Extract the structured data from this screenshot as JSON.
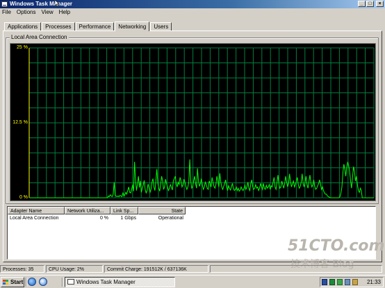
{
  "window": {
    "title": "Windows Task Manager",
    "buttons": {
      "minimize": "_",
      "maximize": "□",
      "close": "×"
    }
  },
  "menu": [
    "File",
    "Options",
    "View",
    "Help"
  ],
  "tabs": [
    {
      "label": "Applications",
      "active": false
    },
    {
      "label": "Processes",
      "active": false
    },
    {
      "label": "Performance",
      "active": false
    },
    {
      "label": "Networking",
      "active": true
    },
    {
      "label": "Users",
      "active": false
    }
  ],
  "graph": {
    "group_label": "Local Area Connection",
    "y_tick_labels": [
      "25 %",
      "12.5 %",
      "0 %"
    ],
    "colors": {
      "background": "#000000",
      "grid": "#008040",
      "line": "#00ff00",
      "axis_label": "#ffff00"
    }
  },
  "chart_data": {
    "type": "line",
    "title": "Local Area Connection",
    "xlabel": "",
    "ylabel": "",
    "ylim": [
      0,
      25
    ],
    "y_ticks": [
      "0 %",
      "12.5 %",
      "25 %"
    ],
    "grid": true,
    "series": [
      {
        "name": "",
        "values": [
          0,
          0,
          0,
          0,
          0,
          0,
          0,
          0,
          0,
          0,
          0,
          0,
          0,
          0,
          0,
          0,
          0,
          0,
          0,
          0,
          0,
          0,
          0,
          0,
          0,
          0,
          0,
          0,
          0,
          0,
          0,
          0,
          0,
          0,
          0,
          0,
          0,
          0,
          0,
          0,
          0,
          0,
          0,
          0,
          0,
          0,
          0,
          0,
          0,
          0,
          0,
          0,
          0,
          0,
          0,
          0,
          0,
          0,
          0,
          0,
          0,
          0,
          0,
          0,
          0,
          0,
          0,
          0,
          0,
          0,
          0,
          0,
          0,
          0,
          0,
          0,
          0,
          0,
          0,
          0,
          0,
          0.3,
          0.2,
          0.5,
          0.3,
          0.2,
          0.6,
          2.6,
          0.4,
          0.3,
          0.2,
          0.3,
          0.2,
          0.4,
          0.3,
          0.2,
          0.8,
          0.3,
          0.5,
          0.9,
          0.6,
          1.2,
          1.8,
          0.9,
          0.8,
          1.4,
          2.2,
          1.1,
          6.0,
          2.8,
          1.2,
          2.4,
          3.6,
          1.7,
          2.8,
          0.9,
          1.6,
          2.1,
          2.9,
          1.4,
          0.8,
          1.2,
          2.3,
          1.6,
          0.9,
          1.4,
          2.6,
          3.2,
          1.8,
          1.2,
          2.8,
          4.8,
          2.4,
          1.6,
          1.1,
          2.2,
          3.6,
          2.8,
          1.4,
          1.8,
          3.1,
          2.4,
          1.8,
          1.2,
          1.6,
          2.2,
          1.8,
          1.3,
          2.8,
          3.2,
          3.6,
          2.4,
          1.8,
          2.6,
          2.2,
          3.4,
          2.8,
          1.8,
          2.2,
          3.1,
          2.6,
          1.9,
          1.4,
          1.8,
          2.6,
          6.4,
          2.8,
          1.6,
          1.9,
          2.8,
          3.6,
          2.4,
          1.6,
          4.9,
          2.8,
          1.9,
          2.4,
          3.2,
          2.1,
          1.4,
          1.8,
          2.6,
          2.2,
          1.6,
          1.4,
          2.8,
          2.4,
          1.8,
          3.4,
          2.6,
          1.9,
          1.6,
          2.2,
          3.6,
          2.8,
          1.8,
          4.1,
          2.6,
          1.8,
          1.4,
          1.9,
          2.4,
          3.0,
          1.8,
          1.2,
          2.0,
          1.6,
          1.3,
          1.8,
          2.4,
          1.6,
          1.2,
          1.4,
          1.8,
          1.2,
          1.6,
          1.1,
          1.3,
          1.8,
          1.4,
          1.2,
          1.6,
          2.1,
          1.4,
          1.8,
          2.6,
          1.6,
          1.2,
          2.4,
          3.0,
          1.8,
          1.4,
          1.6,
          2.2,
          1.6,
          1.8,
          1.2,
          1.6,
          2.4,
          1.8,
          1.4,
          2.4,
          1.6,
          1.4,
          2.1,
          1.6,
          1.8,
          2.2,
          1.4,
          2.0,
          1.8,
          2.6,
          3.4,
          1.8,
          1.4,
          2.6,
          3.8,
          2.2,
          1.6,
          1.8,
          2.8,
          2.2,
          1.6,
          2.4,
          3.6,
          2.6,
          1.8,
          2.4,
          4.0,
          2.6,
          1.8,
          2.4,
          2.8,
          1.8,
          2.2,
          2.8,
          3.4,
          2.2,
          1.6,
          1.9,
          2.6,
          4.0,
          2.4,
          1.8,
          2.6,
          3.6,
          2.2,
          1.6,
          2.8,
          3.8,
          2.4,
          1.8,
          2.2,
          3.0,
          1.9,
          1.4,
          1.6,
          2.0,
          2.4,
          3.0,
          2.2,
          1.4,
          1.8,
          1.2,
          0.8,
          0.6,
          0.6,
          0.3,
          0.2,
          0.1,
          0,
          0,
          0,
          0,
          0,
          0,
          0,
          0,
          0,
          0,
          0.2,
          0.8,
          1.8,
          4.2,
          5.6,
          4.8,
          3.6,
          5.2,
          6.0,
          5.4,
          4.4,
          2.8,
          1.6,
          3.4,
          5.2,
          4.4,
          2.8,
          3.6,
          2.2,
          1.2,
          0.9,
          1.6,
          1.2,
          0,
          0,
          0,
          0,
          0,
          0,
          0,
          0,
          0,
          0,
          0,
          0,
          0
        ]
      }
    ]
  },
  "list": {
    "columns": [
      "Adapter Name",
      "Network Utiliza...",
      "Link Sp...",
      "State"
    ],
    "rows": [
      [
        "Local Area Connection",
        "0 %",
        "1 Gbps",
        "Operational"
      ]
    ]
  },
  "status": {
    "processes": "Processes: 35",
    "cpu": "CPU Usage: 2%",
    "commit": "Commit Charge: 191512K / 637136K"
  },
  "taskbar": {
    "start_label": "Start",
    "task_label": "Windows Task Manager",
    "clock": "21:33"
  },
  "watermark": {
    "line1": "51CTO.com",
    "line2": "技术博客  Blog"
  }
}
